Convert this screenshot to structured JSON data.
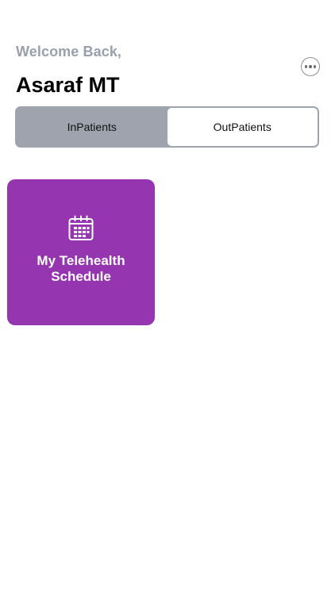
{
  "header": {
    "greeting": "Welcome Back,",
    "user_name": "Asaraf MT",
    "more_icon": "ellipsis-circle-icon"
  },
  "segments": {
    "items": [
      {
        "label": "InPatients",
        "selected": false
      },
      {
        "label": "OutPatients",
        "selected": true
      }
    ]
  },
  "tiles": [
    {
      "label": "My Telehealth Schedule",
      "icon": "calendar-icon",
      "color": "#9535b0"
    }
  ],
  "colors": {
    "greeting": "#9aa0ab",
    "segment_bg": "#9ea3ad",
    "segment_active": "#ffffff",
    "tile": "#9535b0"
  }
}
